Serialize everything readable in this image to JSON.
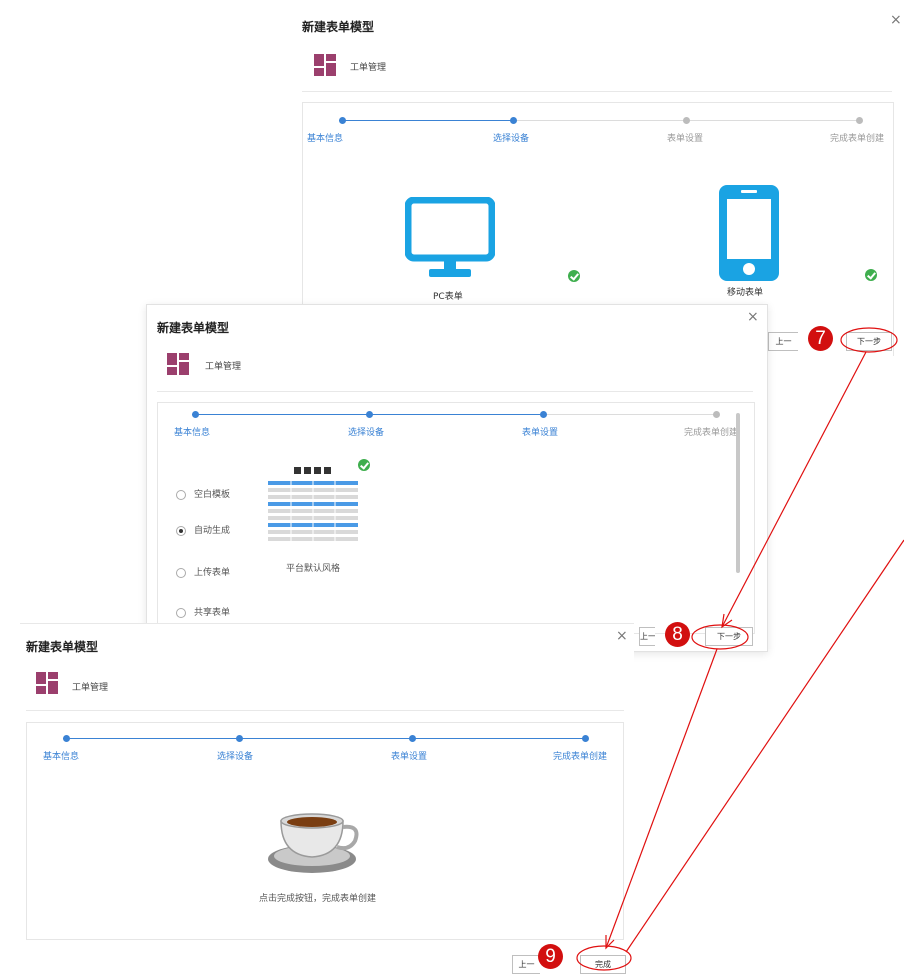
{
  "dialog_title": "新建表单模型",
  "app_name": "工单管理",
  "close_glyph": "×",
  "steps": [
    "基本信息",
    "选择设备",
    "表单设置",
    "完成表单创建"
  ],
  "device_step": {
    "pc_label": "PC表单",
    "mobile_label": "移动表单",
    "next_button": "下一步",
    "prev_button_partial": "上一"
  },
  "settings_step": {
    "options": [
      "空白模板",
      "自动生成",
      "上传表单",
      "共享表单"
    ],
    "selected_option": "自动生成",
    "template_caption": "平台默认风格",
    "next_button": "下一步",
    "prev_button_partial": "上一"
  },
  "finish_step": {
    "message": "点击完成按钮，完成表单创建",
    "finish_button": "完成",
    "prev_button_partial": "上一"
  },
  "callouts": [
    "7",
    "8",
    "9"
  ],
  "colors": {
    "accent": "#3a82d4",
    "app_icon": "#9b3f6d",
    "device_blue": "#1aa3e3",
    "callout_red": "#d20f0f",
    "check_green": "#3fae4e"
  }
}
